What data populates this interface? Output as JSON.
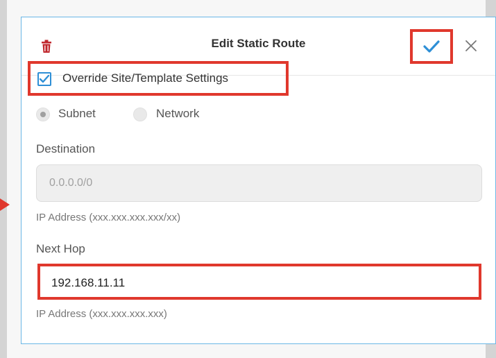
{
  "dialog": {
    "title": "Edit Static Route",
    "accent_color": "#2e8fd6",
    "highlight_color": "#e0382d"
  },
  "override": {
    "label": "Override Site/Template Settings",
    "checked": true
  },
  "radio": {
    "subnet_label": "Subnet",
    "network_label": "Network",
    "selected": "Subnet"
  },
  "destination": {
    "label": "Destination",
    "placeholder": "0.0.0.0/0",
    "hint": "IP Address (xxx.xxx.xxx.xxx/xx)"
  },
  "next_hop": {
    "label": "Next Hop",
    "value": "192.168.11.11",
    "hint": "IP Address (xxx.xxx.xxx.xxx)"
  },
  "icons": {
    "delete": "trash-icon",
    "save": "check-icon",
    "close": "close-icon"
  }
}
